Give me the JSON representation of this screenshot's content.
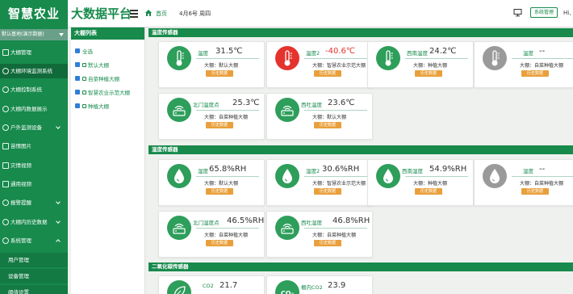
{
  "header": {
    "brand": "智慧农业",
    "title": "大数据平台",
    "home": "首页",
    "date": "4月6号 周四",
    "sysmgr": "系统管理",
    "greeting": "Hi,"
  },
  "sidebar": {
    "base_select": "默认基地(演示数据)",
    "items": [
      {
        "label": "大棚管理"
      },
      {
        "label": "大棚环境监测系统"
      },
      {
        "label": "大棚控制系统"
      },
      {
        "label": "大棚内数据展示"
      },
      {
        "label": "户外监测设备"
      },
      {
        "label": "苗情图片"
      },
      {
        "label": "灾情视频"
      },
      {
        "label": "通用视频"
      },
      {
        "label": "报警提醒"
      },
      {
        "label": "大棚内历史数据"
      },
      {
        "label": "系统管理"
      }
    ],
    "sub_items": [
      {
        "label": "用户管理"
      },
      {
        "label": "设备管理"
      },
      {
        "label": "阈值设置"
      }
    ]
  },
  "list_panel": {
    "title": "大棚列表",
    "items": [
      {
        "label": "全选"
      },
      {
        "label": "默认大棚"
      },
      {
        "label": "自菜种植大棚"
      },
      {
        "label": "智慧农业示范大棚"
      },
      {
        "label": "种植大棚"
      }
    ]
  },
  "sections": [
    {
      "title": "温度传感器",
      "cards": [
        {
          "name": "温度",
          "value": "31.5℃",
          "loc": "大棚：默认大棚",
          "btn": "历史数据",
          "color": "#2e9e5b",
          "icon": "thermometer-icon"
        },
        {
          "name": "温度2",
          "value": "-40.6℃",
          "loc": "大棚：智慧农业示范大棚",
          "btn": "历史数据",
          "color": "#e4332d",
          "icon": "thermometer-icon"
        },
        {
          "name": "西南温度",
          "value": "24.2℃",
          "loc": "大棚：种植大棚",
          "btn": "历史数据",
          "color": "#2e9e5b",
          "icon": "thermometer-icon"
        },
        {
          "name": "温度",
          "value": "--",
          "loc": "大棚：自菜种植大棚",
          "btn": "历史数据",
          "color": "#9a9a9a",
          "icon": "thermometer-icon"
        },
        {
          "name": "北门温度点",
          "value": "25.3℃",
          "loc": "大棚：自菜种植大棚",
          "btn": "历史数据",
          "color": "#2e9e5b",
          "icon": "wireless-sensor-icon"
        },
        {
          "name": "西吐温度",
          "value": "23.6℃",
          "loc": "大棚：默认大棚",
          "btn": "历史数据",
          "color": "#2e9e5b",
          "icon": "wireless-sensor-icon"
        }
      ]
    },
    {
      "title": "湿度传感器",
      "cards": [
        {
          "name": "湿度",
          "value": "65.8%RH",
          "loc": "大棚：默认大棚",
          "btn": "历史数据",
          "color": "#2e9e5b",
          "icon": "droplet-icon"
        },
        {
          "name": "湿度2",
          "value": "30.6%RH",
          "loc": "大棚：智慧农业示范大棚",
          "btn": "历史数据",
          "color": "#2e9e5b",
          "icon": "droplet-icon"
        },
        {
          "name": "西南湿度",
          "value": "54.9%RH",
          "loc": "大棚：种植大棚",
          "btn": "历史数据",
          "color": "#2e9e5b",
          "icon": "droplet-icon"
        },
        {
          "name": "湿度",
          "value": "--",
          "loc": "大棚：自菜种植大棚",
          "btn": "历史数据",
          "color": "#9a9a9a",
          "icon": "droplet-icon"
        },
        {
          "name": "北门湿度点",
          "value": "46.5%RH",
          "loc": "大棚：自菜种植大棚",
          "btn": "历史数据",
          "color": "#2e9e5b",
          "icon": "wireless-sensor-icon"
        },
        {
          "name": "西吐湿度",
          "value": "46.8%RH",
          "loc": "大棚：自菜种植大棚",
          "btn": "历史数据",
          "color": "#2e9e5b",
          "icon": "wireless-sensor-icon"
        }
      ]
    },
    {
      "title": "二氧化碳传感器",
      "cards": [
        {
          "name": "CO2",
          "value": "21.7",
          "loc": "",
          "btn": "",
          "color": "#2e9e5b",
          "icon": "leaf-icon"
        },
        {
          "name": "棚内CO2",
          "value": "23.9",
          "loc": "",
          "btn": "",
          "color": "#2e9e5b",
          "icon": "co2-icon"
        }
      ]
    }
  ]
}
